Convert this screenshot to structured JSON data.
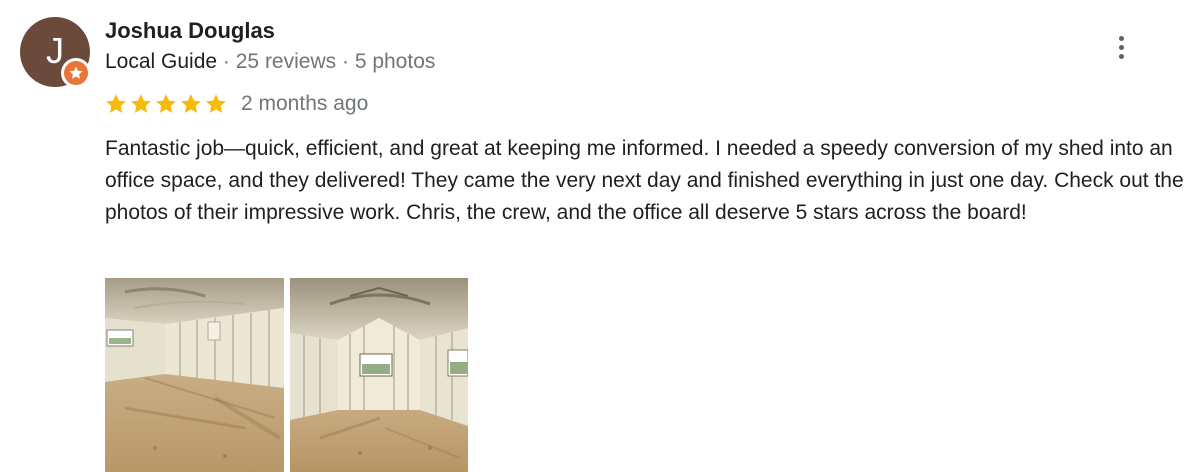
{
  "reviewer": {
    "avatar_letter": "J",
    "name": "Joshua Douglas",
    "badge": "Local Guide",
    "separator_1": " · ",
    "reviews_count": "25 reviews",
    "separator_2": " · ",
    "photos_count": "5 photos"
  },
  "rating": {
    "stars": 5,
    "max_stars": 5,
    "time_ago": "2 months ago",
    "star_color": "#f6bb0a"
  },
  "review": {
    "text": "Fantastic job—quick, efficient, and great at keeping me informed. I needed a speedy conversion of my shed into an office space, and they delivered! They came the very next day and finished everything in just one day. Check out the photos of their impressive work. Chris, the crew, and the office all deserve 5 stars across the board!"
  },
  "photos": [
    {
      "subject": "shed-interior-photo"
    },
    {
      "subject": "shed-interior-photo"
    }
  ],
  "icons": {
    "menu": "more-vert-icon",
    "badge": "local-guide-star-icon",
    "star": "star-icon"
  },
  "colors": {
    "avatar_bg": "#6b4a3c",
    "badge_bg": "#e9753b",
    "muted_text": "#70757a",
    "primary_text": "#1f1f1f"
  }
}
